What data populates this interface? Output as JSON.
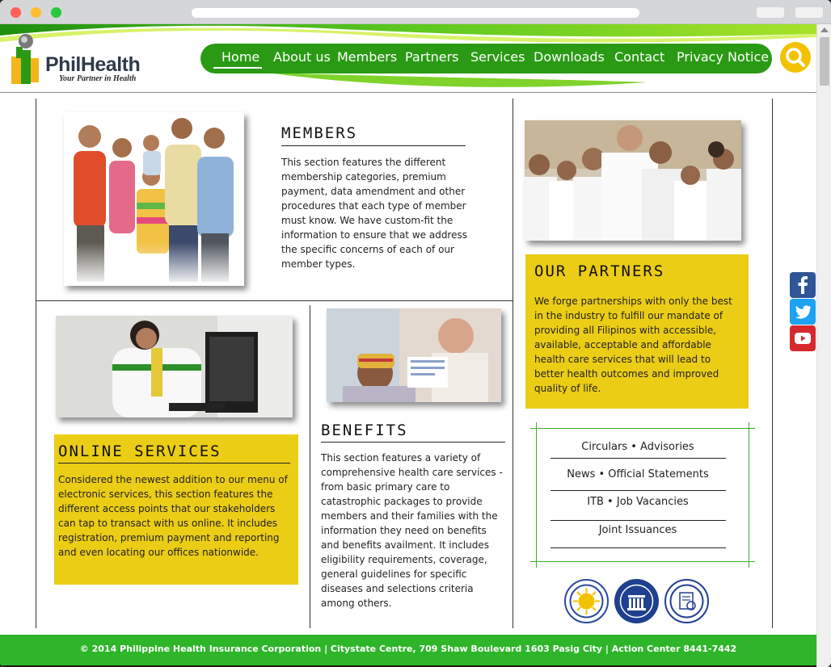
{
  "header": {
    "logo_text": "PhilHealth",
    "logo_tagline": "Your Partner in Health",
    "nav": [
      "Home",
      "About us",
      "Members",
      "Partners",
      "Services",
      "Downloads",
      "Contact",
      "Privacy Notice"
    ],
    "active_nav": "Home",
    "search_icon": "search-icon"
  },
  "sections": {
    "members": {
      "title": "MEMBERS",
      "body": "This section features the different membership categories, premium payment, data amendment and other procedures that each type of member must know. We have custom-fit the information to ensure that we address the specific concerns of each of our member types."
    },
    "partners": {
      "title": "OUR PARTNERS",
      "body": "We forge partnerships with only the best in the industry to fulfill our mandate of providing all Filipinos with accessible, available, acceptable and affordable health care services that will lead to better health outcomes and improved quality of life."
    },
    "online_services": {
      "title": "ONLINE SERVICES",
      "body": "Considered the newest addition to our menu of electronic services, this section features the different access points that our stakeholders can tap to transact with us online. It includes registration, premium payment and reporting and even locating our offices nationwide."
    },
    "benefits": {
      "title": "BENEFITS",
      "body": "This section features a variety of comprehensive health care services -from basic primary care to catastrophic packages to provide members and their families with the information they need on benefits and benefits availment. It includes eligibility requirements, coverage, general guidelines for specific diseases and selections criteria among others."
    }
  },
  "links": [
    "Circulars • Advisories",
    "News • Official Statements",
    "ITB • Job Vacancies",
    "Joint Issuances"
  ],
  "social": [
    "facebook-icon",
    "twitter-icon",
    "youtube-icon"
  ],
  "footer": {
    "text": "© 2014 Philippine Health Insurance Corporation | Citystate Centre, 709 Shaw Boulevard 1603 Pasig City | Action Center 8441-7442"
  },
  "colors": {
    "brand_green": "#2a9a14",
    "footer_green": "#2eb52a",
    "accent_yellow": "#ebcd16",
    "search_yellow": "#f2c200"
  }
}
